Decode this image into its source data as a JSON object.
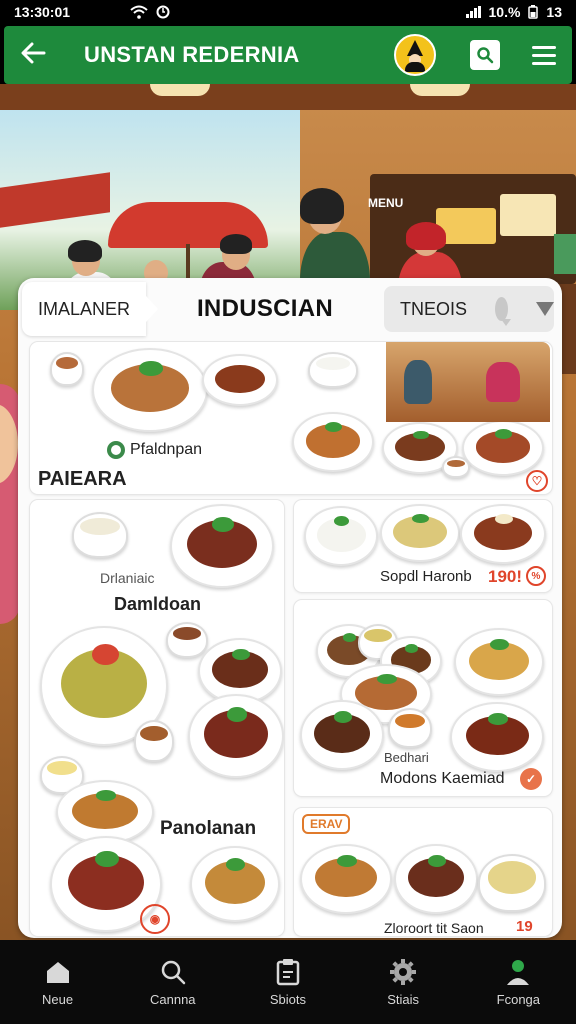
{
  "status_bar": {
    "time": "13:30:01",
    "battery": "10.%",
    "right_time": "13"
  },
  "app_bar": {
    "back_icon": "arrow-left-icon",
    "title": "UNSTAN REDERNIA",
    "search_icon": "search-icon",
    "menu_icon": "hamburger-menu-icon"
  },
  "panel": {
    "tab_left": "IMALANER",
    "tab_center": "INDUSCIAN",
    "tab_right": "TNEOIS",
    "cards": {
      "card1": {
        "sub_label": "Pfaldnpan",
        "label": "PAIEARA"
      },
      "card2": {
        "sub_label": "Drlaniaic",
        "label": "Damldoan"
      },
      "card3": {
        "label": "Sopdl Haronb",
        "price": "190!"
      },
      "card4": {
        "sub_label": "Bedhari",
        "label": "Modons Kaemiad"
      },
      "card5": {
        "label": "Panolanan"
      },
      "card6": {
        "tag": "ERAV",
        "label": "Zloroort tit Saon",
        "price": "19"
      }
    }
  },
  "bottom_nav": [
    {
      "label": "Neue",
      "icon": "home-icon"
    },
    {
      "label": "Cannna",
      "icon": "search-icon"
    },
    {
      "label": "Sbiots",
      "icon": "clipboard-icon"
    },
    {
      "label": "Stiais",
      "icon": "gear-icon"
    },
    {
      "label": "Fconga",
      "icon": "profile-icon"
    }
  ],
  "colors": {
    "brand_green": "#1e8a3c",
    "accent_red": "#e0452b",
    "panel_bg": "#fbfbfb"
  }
}
